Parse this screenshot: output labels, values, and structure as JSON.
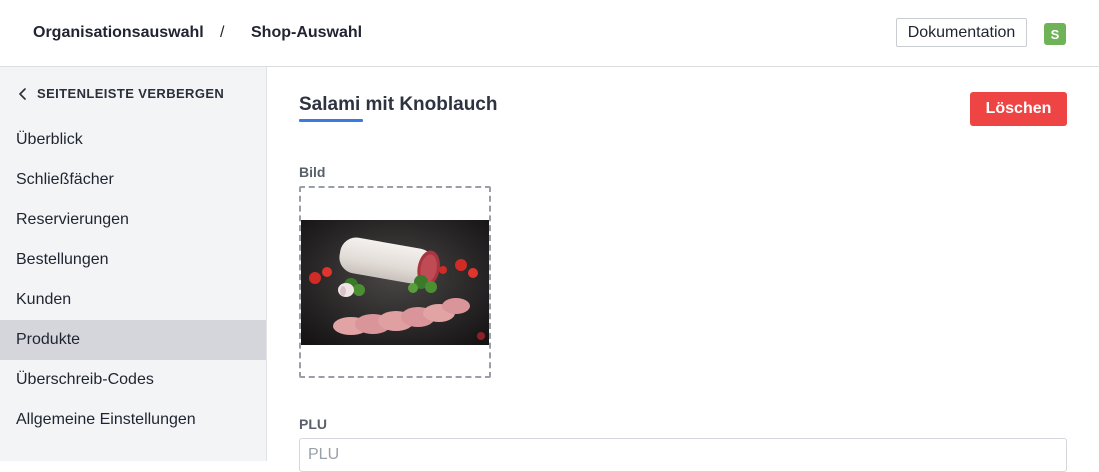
{
  "header": {
    "breadcrumb": {
      "organisation": "Organisationsauswahl",
      "separator": "/",
      "shop": "Shop-Auswahl"
    },
    "documentation_label": "Dokumentation",
    "avatar_initial": "S"
  },
  "sidebar": {
    "toggle_label": "SEITENLEISTE VERBERGEN",
    "items": [
      {
        "label": "Überblick",
        "active": false
      },
      {
        "label": "Schließfächer",
        "active": false
      },
      {
        "label": "Reservierungen",
        "active": false
      },
      {
        "label": "Bestellungen",
        "active": false
      },
      {
        "label": "Kunden",
        "active": false
      },
      {
        "label": "Produkte",
        "active": true
      },
      {
        "label": "Überschreib-Codes",
        "active": false
      },
      {
        "label": "Allgemeine Einstellungen",
        "active": false
      }
    ]
  },
  "main": {
    "title": "Salami mit Knoblauch",
    "delete_label": "Löschen",
    "image_field": {
      "label": "Bild"
    },
    "plu_field": {
      "label": "PLU",
      "value": "",
      "placeholder": "PLU"
    }
  },
  "colors": {
    "accent": "#3b7be0",
    "danger": "#ee4444",
    "avatar": "#6fb257",
    "sidebar_bg": "#f3f4f6",
    "sidebar_active": "#d4d6db"
  }
}
